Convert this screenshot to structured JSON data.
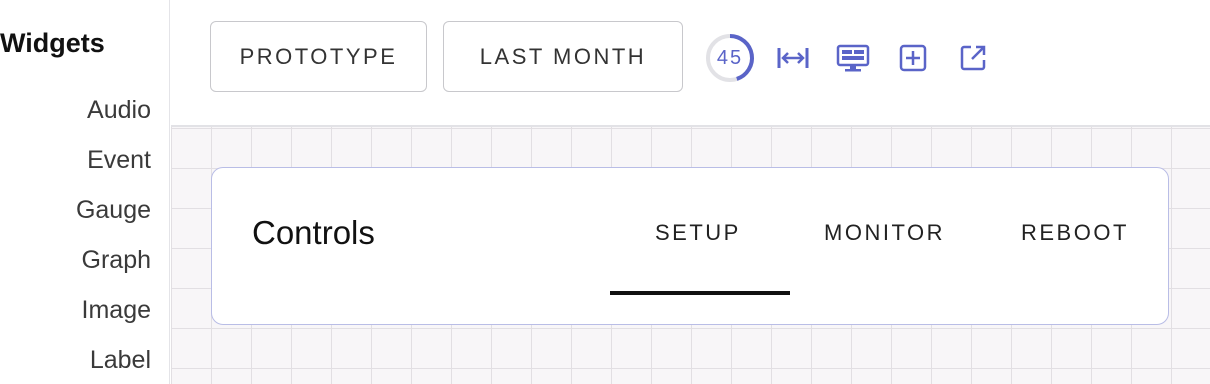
{
  "sidebar": {
    "title": "Widgets",
    "items": [
      "Audio",
      "Event",
      "Gauge",
      "Graph",
      "Image",
      "Label"
    ]
  },
  "toolbar": {
    "prototype_label": "PROTOTYPE",
    "period_label": "LAST MONTH",
    "zoom_value": "45",
    "icons": [
      "fit-width-icon",
      "monitor-icon",
      "add-box-icon",
      "open-external-icon"
    ],
    "accent_color": "#5a64c8"
  },
  "card": {
    "title": "Controls",
    "tabs": [
      "SETUP",
      "MONITOR",
      "REBOOT"
    ],
    "active_tab": "SETUP"
  }
}
